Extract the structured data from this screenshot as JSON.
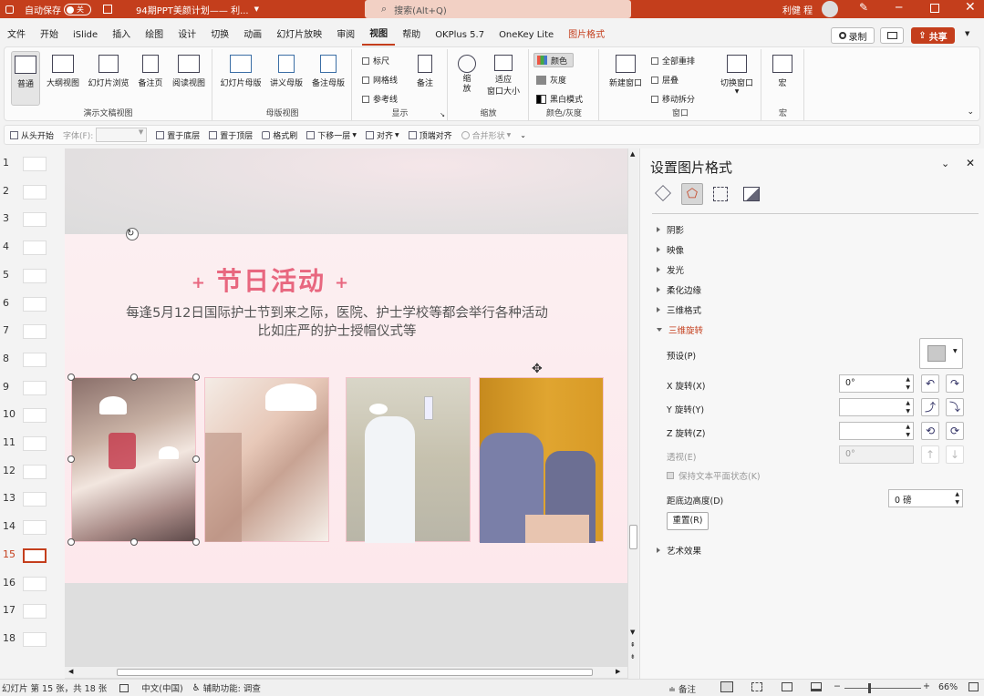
{
  "titlebar": {
    "autosave_label": "自动保存",
    "autosave_state": "关",
    "doc_title": "94期PPT美颜计划—— 利...",
    "search_placeholder": "搜索(Alt+Q)",
    "user_name": "利健 程"
  },
  "menu": {
    "items": [
      "文件",
      "开始",
      "iSlide",
      "插入",
      "绘图",
      "设计",
      "切换",
      "动画",
      "幻灯片放映",
      "审阅",
      "视图",
      "帮助",
      "OKPlus 5.7",
      "OneKey Lite",
      "图片格式"
    ],
    "record_label": "录制",
    "share_label": "共享"
  },
  "ribbon": {
    "views": {
      "normal": "普通",
      "outline": "大纲视图",
      "sorter": "幻灯片浏览",
      "notes_page": "备注页",
      "reading": "阅读视图",
      "group": "演示文稿视图"
    },
    "master": {
      "slide_master": "幻灯片母版",
      "handout_master": "讲义母版",
      "notes_master": "备注母版",
      "group": "母版视图"
    },
    "show": {
      "ruler": "标尺",
      "gridlines": "网格线",
      "guides": "参考线",
      "notes": "备注",
      "group": "显示"
    },
    "zoom": {
      "zoom": "缩放",
      "fit_line1": "适应",
      "fit_line2": "窗口大小",
      "group": "缩放"
    },
    "color": {
      "color": "颜色",
      "grayscale": "灰度",
      "bw": "黑白模式",
      "group": "颜色/灰度"
    },
    "window": {
      "new_window": "新建窗口",
      "arrange_all": "全部重排",
      "cascade": "层叠",
      "move_split": "移动拆分",
      "switch_window": "切换窗口",
      "group": "窗口"
    },
    "macros": {
      "macro": "宏",
      "group": "宏"
    }
  },
  "quickbar": {
    "from_start": "从头开始",
    "font_label": "字体(F):",
    "send_to_back": "置于底层",
    "bring_to_front": "置于顶层",
    "format_painter": "格式刷",
    "send_backward": "下移一层",
    "align": "对齐",
    "align_top": "顶端对齐",
    "merge_shapes": "合并形状"
  },
  "thumbnails": [
    "1",
    "2",
    "3",
    "4",
    "5",
    "6",
    "7",
    "8",
    "9",
    "10",
    "11",
    "12",
    "13",
    "14",
    "15",
    "16",
    "17",
    "18"
  ],
  "selected_slide_index": 14,
  "slide": {
    "title": "节日活动",
    "plus_left": "+",
    "plus_right": "+",
    "line1": "每逢5月12日国际护士节到来之际，医院、护士学校等都会举行各种活动",
    "line2": "比如庄严的护士授帽仪式等"
  },
  "pane": {
    "title": "设置图片格式",
    "sections": {
      "shadow": "阴影",
      "reflection": "映像",
      "glow": "发光",
      "soft_edges": "柔化边缘",
      "format_3d": "三维格式",
      "rotation_3d": "三维旋转",
      "artistic": "艺术效果"
    },
    "presets_label": "预设(P)",
    "x_label": "X 旋转(X)",
    "x_value": "0°",
    "y_label": "Y 旋转(Y)",
    "y_value": "",
    "z_label": "Z 旋转(Z)",
    "z_value": "",
    "persp_label": "透视(E)",
    "persp_value": "0°",
    "keep_flat": "保持文本平面状态(K)",
    "distance_label": "距底边高度(D)",
    "distance_value": "0 磅",
    "reset": "重置(R)"
  },
  "status": {
    "slide_info": "幻灯片 第 15 张，共 18 张",
    "language": "中文(中国)",
    "accessibility": "辅助功能: 调查",
    "notes": "备注",
    "zoom": "66%"
  },
  "colors": {
    "accent": "#c43e1c",
    "slide_title": "#e8677f"
  }
}
